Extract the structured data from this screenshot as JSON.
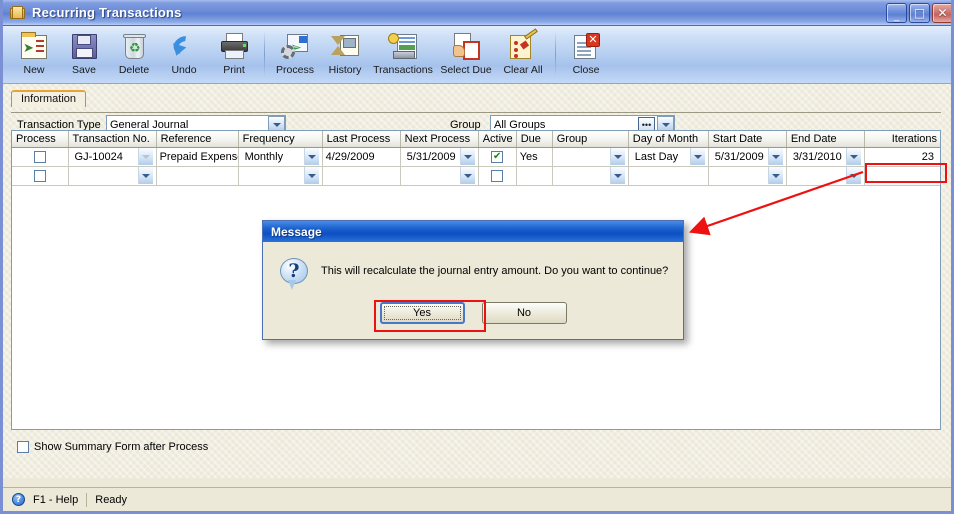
{
  "window": {
    "title": "Recurring Transactions",
    "icon": "folder-icon",
    "minimize_label": "_",
    "maximize_label": "□",
    "close_label": "✕"
  },
  "toolbar": {
    "buttons": [
      {
        "label": "New",
        "icon": "new-document-icon"
      },
      {
        "label": "Save",
        "icon": "floppy-disk-icon"
      },
      {
        "label": "Delete",
        "icon": "recycle-bin-icon"
      },
      {
        "label": "Undo",
        "icon": "undo-arrow-icon"
      },
      {
        "label": "Print",
        "icon": "printer-icon"
      },
      {
        "label": "Process",
        "icon": "gear-process-icon"
      },
      {
        "label": "History",
        "icon": "hourglass-history-icon"
      },
      {
        "label": "Transactions",
        "icon": "cash-register-icon"
      },
      {
        "label": "Select Due",
        "icon": "hand-select-icon"
      },
      {
        "label": "Clear All",
        "icon": "clipboard-brush-icon"
      },
      {
        "label": "Close",
        "icon": "document-close-icon"
      }
    ]
  },
  "tabs": [
    {
      "label": "Information",
      "active": true
    }
  ],
  "form": {
    "transaction_type": {
      "label": "Transaction Type",
      "value": "General Journal"
    },
    "group": {
      "label": "Group",
      "value": "All Groups",
      "ellipsis_label": "•••"
    }
  },
  "grid": {
    "columns": [
      {
        "key": "process",
        "label": "Process",
        "align": "center"
      },
      {
        "key": "transaction",
        "label": "Transaction No.",
        "align": "left"
      },
      {
        "key": "reference",
        "label": "Reference",
        "align": "left"
      },
      {
        "key": "frequency",
        "label": "Frequency",
        "align": "left"
      },
      {
        "key": "last_process",
        "label": "Last Process",
        "align": "left"
      },
      {
        "key": "next_process",
        "label": "Next Process",
        "align": "left"
      },
      {
        "key": "active",
        "label": "Active",
        "align": "center"
      },
      {
        "key": "due",
        "label": "Due",
        "align": "left"
      },
      {
        "key": "group",
        "label": "Group",
        "align": "left"
      },
      {
        "key": "day_of_month",
        "label": "Day of Month",
        "align": "left"
      },
      {
        "key": "start_date",
        "label": "Start Date",
        "align": "left"
      },
      {
        "key": "end_date",
        "label": "End Date",
        "align": "left"
      },
      {
        "key": "iterations",
        "label": "Iterations",
        "align": "right"
      }
    ],
    "rows": [
      {
        "process": "",
        "process_checked": false,
        "transaction": "GJ-10024",
        "reference": "Prepaid Expense",
        "frequency": "Monthly",
        "last_process": "4/29/2009",
        "next_process": "5/31/2009",
        "active_checked": true,
        "due": "Yes",
        "group": "",
        "day_of_month": "Last Day",
        "start_date": "5/31/2009",
        "end_date": "3/31/2010",
        "iterations": "23"
      },
      {
        "process": "",
        "process_checked": false,
        "transaction": "",
        "reference": "",
        "frequency": "",
        "last_process": "",
        "next_process": "",
        "active_checked": false,
        "due": "",
        "group": "",
        "day_of_month": "",
        "start_date": "",
        "end_date": "",
        "iterations": ""
      }
    ]
  },
  "options": {
    "show_summary": {
      "label": "Show Summary Form after Process",
      "checked": false
    }
  },
  "status": {
    "help_label": "F1 - Help",
    "help_icon": "question-mark-icon",
    "message": "Ready"
  },
  "dialog": {
    "title": "Message",
    "icon": "question-bubble-icon",
    "message": "This will recalculate the journal entry amount. Do you want to continue?",
    "buttons": [
      {
        "label": "Yes",
        "mnemonic": "Y",
        "focused": true
      },
      {
        "label": "No",
        "mnemonic": "N",
        "focused": false
      }
    ]
  },
  "annotations": {
    "highlight_color": "#ee1111",
    "boxes": [
      "iterations-cell",
      "yes-button"
    ],
    "arrow": "from-iterations-cell-to-dialog"
  }
}
